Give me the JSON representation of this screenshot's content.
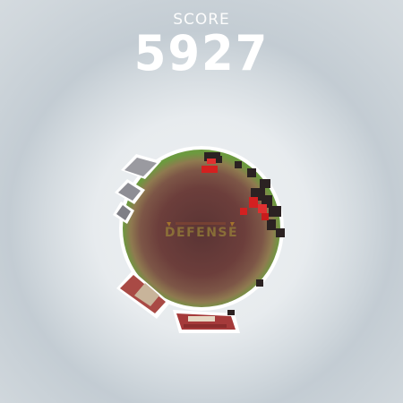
{
  "hud": {
    "score_label": "SCORE",
    "score_value": "5927"
  },
  "game": {
    "title_main": "DEFENSE"
  },
  "colors": {
    "planet_rim": "#6c9a3f",
    "planet_core": "#4a2a2a",
    "enemy": "#d42020",
    "debris": "#2b2222"
  }
}
